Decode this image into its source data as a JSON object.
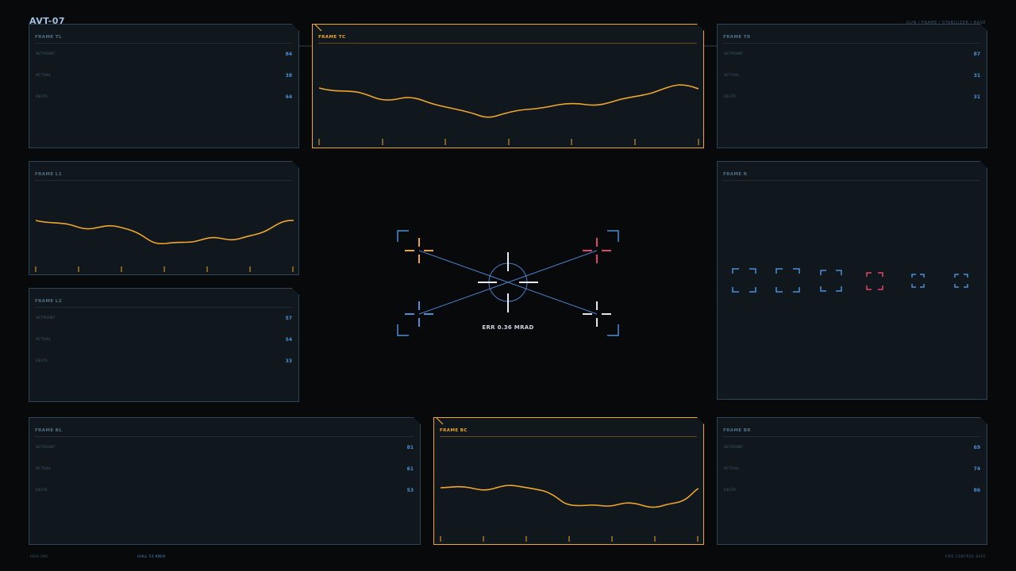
{
  "header": {
    "callsign": "AVT-07",
    "status": "GUN / FRAME / STABILIZER / BASE"
  },
  "frames": {
    "tl": {
      "title": "FRAME TL",
      "metrics": [
        {
          "label": "SETPOINT",
          "value": "84"
        },
        {
          "label": "ACTUAL",
          "value": "38"
        },
        {
          "label": "DELTA",
          "value": "64"
        }
      ]
    },
    "tc": {
      "title": "FRAME TC"
    },
    "tr": {
      "title": "FRAME TR",
      "metrics": [
        {
          "label": "SETPOINT",
          "value": "87"
        },
        {
          "label": "ACTUAL",
          "value": "31"
        },
        {
          "label": "DELTA",
          "value": "31"
        }
      ]
    },
    "l1": {
      "title": "FRAME L1"
    },
    "l2": {
      "title": "FRAME L2",
      "metrics": [
        {
          "label": "SETPOINT",
          "value": "57"
        },
        {
          "label": "ACTUAL",
          "value": "54"
        },
        {
          "label": "DELTA",
          "value": "33"
        }
      ]
    },
    "r": {
      "title": "FRAME R"
    },
    "bl": {
      "title": "FRAME BL",
      "metrics": [
        {
          "label": "SETPOINT",
          "value": "81"
        },
        {
          "label": "ACTUAL",
          "value": "61"
        },
        {
          "label": "DELTA",
          "value": "53"
        }
      ]
    },
    "bc": {
      "title": "FRAME BC"
    },
    "br": {
      "title": "FRAME BR",
      "metrics": [
        {
          "label": "SETPOINT",
          "value": "69"
        },
        {
          "label": "ACTUAL",
          "value": "74"
        },
        {
          "label": "DELTA",
          "value": "86"
        }
      ]
    }
  },
  "reticle": {
    "error_readout": "ERR 0.36 MRAD"
  },
  "footer": {
    "left": "HDG 295",
    "center": "HULL 53 KM/H",
    "right": "FIRE CONTROL SAFE"
  },
  "colors": {
    "accent": "#f0a62a",
    "frame_border": "#2e4456",
    "value_blue": "#4a8fd8",
    "alert_pink": "#e0456a"
  }
}
